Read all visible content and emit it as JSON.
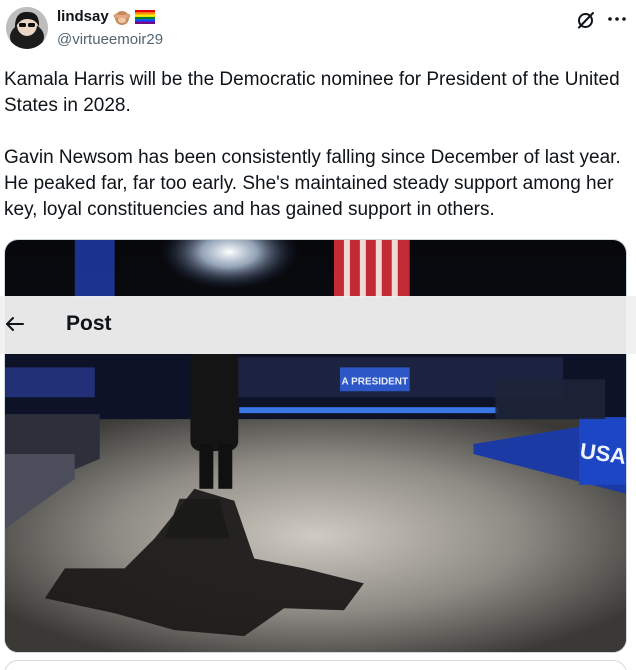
{
  "header": {
    "title": "Post"
  },
  "author": {
    "name": "lindsay",
    "handle": "@virtueemoir29",
    "badges": [
      "see-no-evil-monkey-emoji",
      "rainbow-flag-emoji"
    ]
  },
  "tweet": {
    "paragraphs": [
      "Kamala Harris will be the Democratic nominee for President of the United States in 2028.",
      "Gavin Newsom has been consistently falling since December of last year. He peaked far, far too early. She's maintained steady support among her key, loyal constituencies and has gained support in others."
    ]
  },
  "media": {
    "sign_text": "A PRESIDENT",
    "banner_text": "USA",
    "icons": [
      "stage-photo"
    ]
  },
  "icons": {
    "back": "back-arrow-icon",
    "grok": "grok-icon",
    "more": "more-icon"
  },
  "colors": {
    "text": "#0f1419",
    "muted": "#536471",
    "border": "#cfd9de"
  }
}
